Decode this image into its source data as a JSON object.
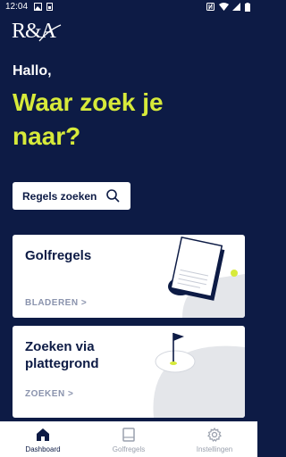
{
  "status_bar": {
    "time": "12:04"
  },
  "logo": {
    "text": "R&A"
  },
  "greeting": "Hallo,",
  "headline": "Waar zoek je naar?",
  "search": {
    "label": "Regels zoeken"
  },
  "cards": [
    {
      "title": "Golfregels",
      "link": "BLADEREN >"
    },
    {
      "title": "Zoeken via plattegrond",
      "link": "ZOEKEN >"
    }
  ],
  "bottom_nav": [
    {
      "label": "Dashboard",
      "active": true
    },
    {
      "label": "Golfregels",
      "active": false
    },
    {
      "label": "Instellingen",
      "active": false
    }
  ],
  "colors": {
    "navy": "#0d1b45",
    "accent": "#d7ea3a",
    "muted": "#9aa0ad"
  }
}
